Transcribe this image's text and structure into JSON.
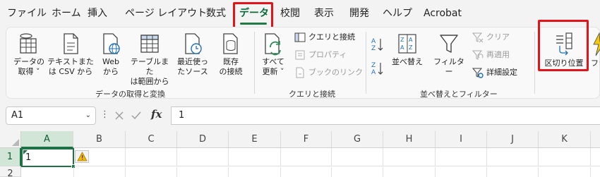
{
  "menu": {
    "items": [
      "ファイル",
      "ホーム",
      "挿入",
      "ページ レイアウト",
      "数式",
      "データ",
      "校閲",
      "表示",
      "開発",
      "ヘルプ",
      "Acrobat"
    ],
    "active": "データ"
  },
  "ribbon": {
    "get_data": {
      "label1": "データの",
      "label2": "取得 ˅",
      "group_label": "データの取得と変換"
    },
    "from_text": {
      "label1": "テキストまた",
      "label2": "は CSV から"
    },
    "from_web": {
      "label1": "Web",
      "label2": "から"
    },
    "from_table": {
      "label1": "テーブルまた",
      "label2": "は範囲から"
    },
    "recent": {
      "label1": "最近使っ",
      "label2": "たソース"
    },
    "existing": {
      "label1": "既存",
      "label2": "の接続"
    },
    "refresh": {
      "label1": "すべて",
      "label2": "更新 ˅"
    },
    "queries": {
      "queries_connections": "クエリと接続",
      "properties": "プロパティ",
      "edit_links": "ブックのリンク",
      "group_label": "クエリと接続"
    },
    "sort": {
      "sort_label": "並べ替え",
      "filter_label": "フィルター",
      "clear": "クリア",
      "reapply": "再適用",
      "advanced": "詳細設定",
      "group_label": "並べ替えとフィルター"
    },
    "text_to_columns": {
      "label": "区切り位置"
    },
    "flash_fill": {
      "label": "フラ"
    }
  },
  "formula_bar": {
    "name_box": "A1",
    "formula": "1",
    "fx": "fx"
  },
  "sheet": {
    "columns": [
      "A",
      "B",
      "C",
      "D",
      "E",
      "F",
      "G",
      "H",
      "I",
      "J",
      "K"
    ],
    "rows": [
      "1",
      "2"
    ],
    "cells": {
      "A1": "1"
    }
  },
  "colors": {
    "accent": "#1e7145",
    "highlight_box": "#e2141a"
  }
}
